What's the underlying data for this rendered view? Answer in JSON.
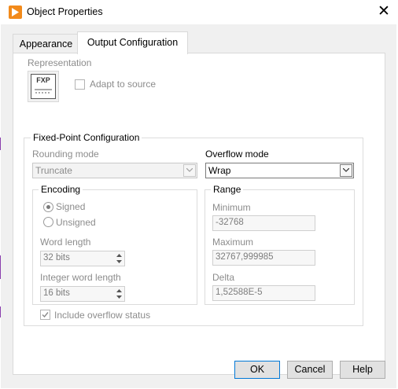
{
  "window": {
    "title": "Object Properties"
  },
  "tabs": [
    {
      "label": "Appearance"
    },
    {
      "label": "Output Configuration"
    }
  ],
  "representation": {
    "label": "Representation",
    "icon_text": "FXP",
    "adapt_label": "Adapt to source",
    "adapt_checked": false
  },
  "fixed_point": {
    "title": "Fixed-Point Configuration",
    "rounding_label": "Rounding mode",
    "rounding_value": "Truncate",
    "overflow_label": "Overflow mode",
    "overflow_value": "Wrap",
    "encoding": {
      "title": "Encoding",
      "signed_label": "Signed",
      "unsigned_label": "Unsigned",
      "selected": "Signed",
      "word_length_label": "Word length",
      "word_length_value": "32 bits",
      "integer_word_length_label": "Integer word length",
      "integer_word_length_value": "16 bits"
    },
    "range": {
      "title": "Range",
      "minimum_label": "Minimum",
      "minimum_value": "-32768",
      "maximum_label": "Maximum",
      "maximum_value": "32767,999985",
      "delta_label": "Delta",
      "delta_value": "1,52588E-5"
    },
    "include_overflow_label": "Include overflow status",
    "include_overflow_checked": true
  },
  "buttons": {
    "ok": "OK",
    "cancel": "Cancel",
    "help": "Help"
  },
  "colors": {
    "title_icon": "#f28a1b",
    "window_edge": "#8a3fae"
  }
}
